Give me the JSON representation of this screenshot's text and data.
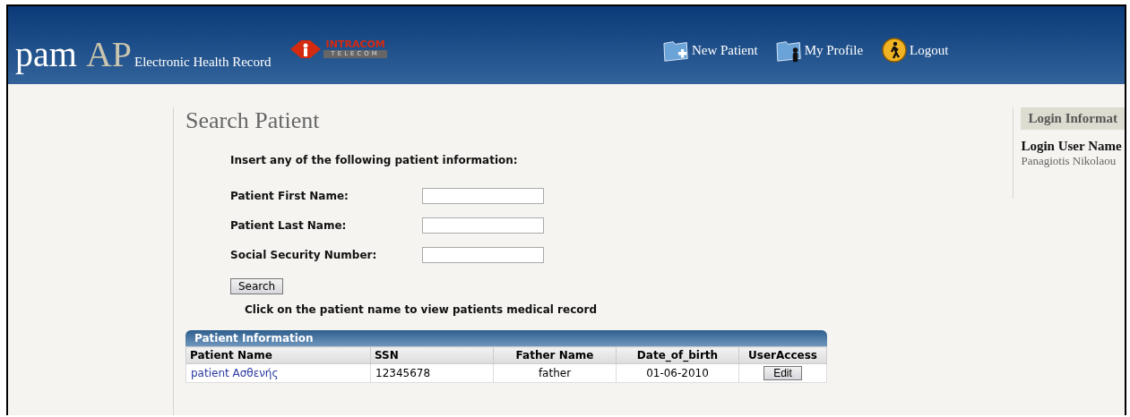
{
  "header": {
    "logo": {
      "main": "pam",
      "accent": "AP",
      "subtitle": "Electronic Health Record"
    },
    "partner_logo": {
      "name": "INTRACOM",
      "tagline": "TELECOM"
    },
    "nav": [
      {
        "kind": "new",
        "label": "New Patient"
      },
      {
        "kind": "profile",
        "label": "My Profile"
      },
      {
        "kind": "logout",
        "label": "Logout"
      }
    ]
  },
  "search": {
    "title": "Search Patient",
    "intro": "Insert any of the following patient information:",
    "fields": [
      {
        "label": "Patient First Name:"
      },
      {
        "label": "Patient Last Name:"
      },
      {
        "label": "Social Security Number:"
      }
    ],
    "button": "Search",
    "hint": "Click on the patient name to view patients medical record"
  },
  "table": {
    "title": "Patient Information",
    "columns": [
      "Patient Name",
      "SSN",
      "Father Name",
      "Date_of_birth",
      "UserAccess"
    ],
    "rows": [
      {
        "name": "patient Ασθενής",
        "ssn": "12345678",
        "father": "father",
        "dob": "01-06-2010",
        "action": "Edit"
      }
    ]
  },
  "sidebar": {
    "title": "Login Informat",
    "label": "Login User Name",
    "value": "Panagiotis Nikolaou"
  }
}
